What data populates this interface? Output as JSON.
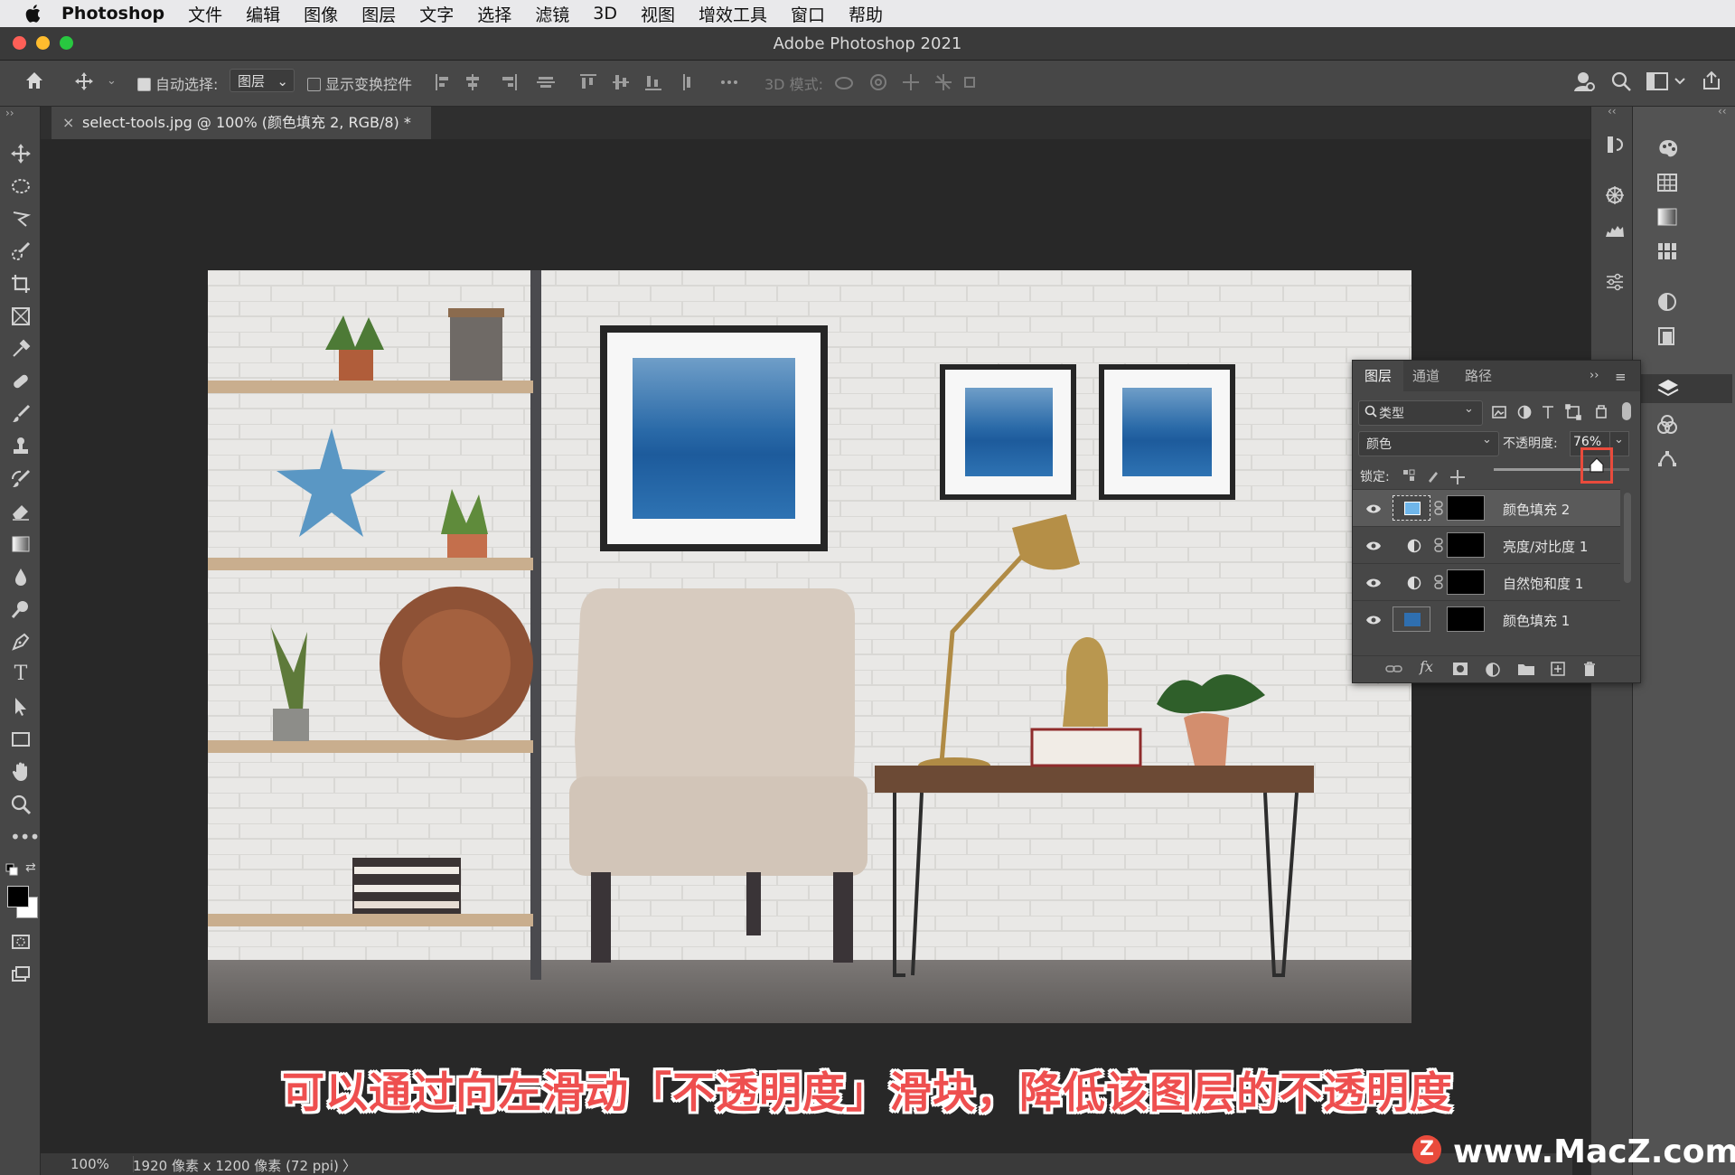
{
  "menubar": {
    "app_name": "Photoshop",
    "items": [
      "文件",
      "编辑",
      "图像",
      "图层",
      "文字",
      "选择",
      "滤镜",
      "3D",
      "视图",
      "增效工具",
      "窗口",
      "帮助"
    ]
  },
  "window": {
    "title": "Adobe Photoshop 2021"
  },
  "options_bar": {
    "auto_select_label": "自动选择:",
    "auto_select_checked": true,
    "auto_select_target": "图层",
    "show_transform_label": "显示变换控件",
    "show_transform_checked": false,
    "mode_3d_label": "3D 模式:"
  },
  "document": {
    "tab_title": "select-tools.jpg @ 100% (颜色填充 2, RGB/8) *",
    "close_glyph": "×"
  },
  "status": {
    "zoom": "100%",
    "info": "1920 像素 x 1200 像素 (72 ppi)",
    "arrow": "〉"
  },
  "layers_panel": {
    "tabs": [
      "图层",
      "通道",
      "路径"
    ],
    "filter_label": "类型",
    "blend_mode": "颜色",
    "opacity_label": "不透明度:",
    "opacity_value": "76%",
    "opacity_fraction": 0.76,
    "lock_label": "锁定:",
    "layers": [
      {
        "name": "颜色填充 2",
        "selected": true,
        "thumb": "color-fill",
        "color": "#6fb6ea"
      },
      {
        "name": "亮度/对比度 1",
        "selected": false,
        "thumb": "adjustment"
      },
      {
        "name": "自然饱和度 1",
        "selected": false,
        "thumb": "adjustment"
      },
      {
        "name": "颜色填充 1",
        "selected": false,
        "thumb": "color-fill",
        "color": "#2f6fb0"
      }
    ]
  },
  "caption": "可以通过向左滑动「不透明度」滑块，降低该图层的不透明度",
  "watermark": "www.MacZ.com",
  "colors": {
    "accent_red": "#e94b3c",
    "ps_bg": "#282828",
    "panel": "#474747"
  }
}
